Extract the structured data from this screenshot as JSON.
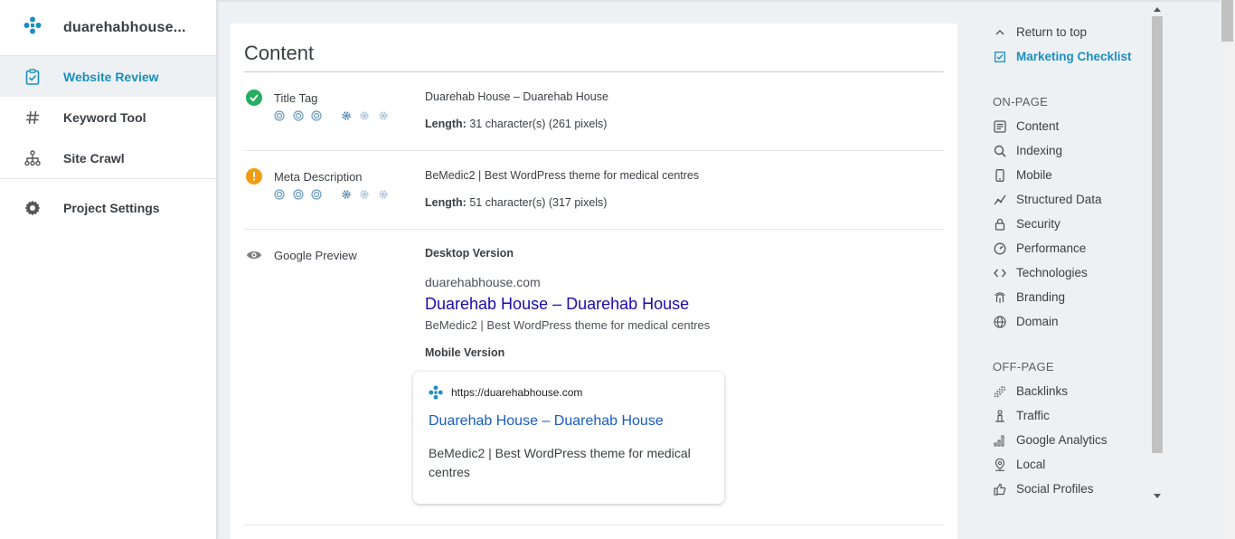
{
  "sidebar": {
    "brand_name": "duarehabhouse...",
    "items": [
      {
        "label": "Website Review",
        "icon": "clipboard-check-icon",
        "active": true
      },
      {
        "label": "Keyword Tool",
        "icon": "hash-icon"
      },
      {
        "label": "Site Crawl",
        "icon": "sitemap-icon"
      },
      {
        "label": "Project Settings",
        "icon": "gear-icon"
      }
    ]
  },
  "content": {
    "title": "Content",
    "title_tag": {
      "name": "Title Tag",
      "status": "pass",
      "value": "Duarehab House – Duarehab House",
      "length_label": "Length:",
      "length_value": "31 character(s) (261 pixels)"
    },
    "meta_description": {
      "name": "Meta Description",
      "status": "warning",
      "value": "BeMedic2 | Best WordPress theme for medical centres",
      "length_label": "Length:",
      "length_value": "51 character(s) (317 pixels)"
    },
    "google_preview": {
      "name": "Google Preview",
      "desktop_label": "Desktop Version",
      "desktop_url": "duarehabhouse.com",
      "desktop_title": "Duarehab House – Duarehab House",
      "desktop_desc": "BeMedic2 | Best WordPress theme for medical centres",
      "mobile_label": "Mobile Version",
      "mobile_url": "https://duarehabhouse.com",
      "mobile_title": "Duarehab House – Duarehab House",
      "mobile_desc": "BeMedic2 | Best WordPress theme for medical centres"
    }
  },
  "right_nav": {
    "return_to_top": "Return to top",
    "marketing_checklist": "Marketing Checklist",
    "on_page_heading": "ON-PAGE",
    "on_page": [
      "Content",
      "Indexing",
      "Mobile",
      "Structured Data",
      "Security",
      "Performance",
      "Technologies",
      "Branding",
      "Domain"
    ],
    "off_page_heading": "OFF-PAGE",
    "off_page": [
      "Backlinks",
      "Traffic",
      "Google Analytics",
      "Local",
      "Social Profiles"
    ]
  },
  "colors": {
    "accent": "#1a8fbf",
    "pass": "#27ae60",
    "warning": "#f39c12",
    "google_link": "#1a0dab"
  }
}
